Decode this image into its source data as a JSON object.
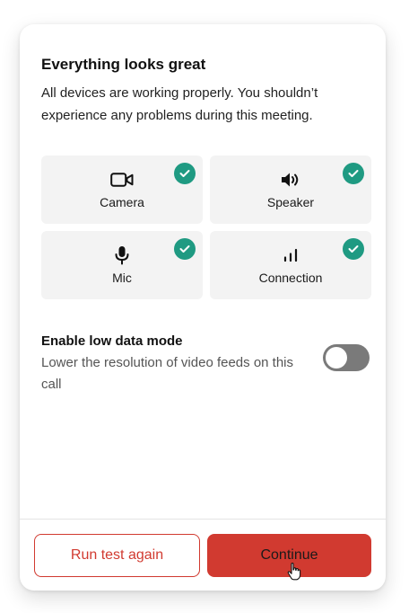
{
  "header": {
    "title": "Everything looks great",
    "description": "All devices are working properly. You shouldn’t experience any problems during this meeting."
  },
  "devices": [
    {
      "label": "Camera",
      "icon": "camera-icon",
      "status": "ok"
    },
    {
      "label": "Speaker",
      "icon": "speaker-icon",
      "status": "ok"
    },
    {
      "label": "Mic",
      "icon": "mic-icon",
      "status": "ok"
    },
    {
      "label": "Connection",
      "icon": "signal-icon",
      "status": "ok"
    }
  ],
  "low_data_mode": {
    "title": "Enable low data mode",
    "description": "Lower the resolution of video feeds on this call",
    "enabled": false
  },
  "footer": {
    "secondary_label": "Run test again",
    "primary_label": "Continue"
  },
  "colors": {
    "accent": "#d13a30",
    "success": "#1f9a82",
    "toggle_off": "#7a7a7a",
    "tile_bg": "#f3f3f3"
  }
}
